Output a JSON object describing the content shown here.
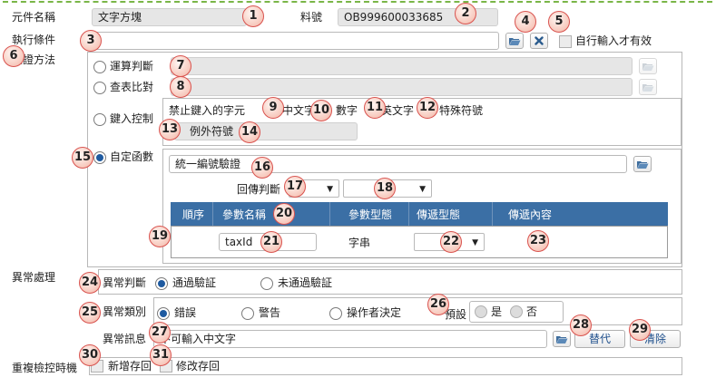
{
  "form": {
    "component_name": {
      "label": "元件名稱",
      "value": "文字方塊"
    },
    "part_no": {
      "label": "料號",
      "value": "OB999600033685"
    },
    "exec_condition": {
      "label": "執行條件",
      "value": "",
      "self_input_label": "自行輸入才有效"
    },
    "verify_method": {
      "label": "驗證方法",
      "calc": {
        "label": "運算判斷",
        "value": ""
      },
      "lookup": {
        "label": "查表比對",
        "value": ""
      },
      "key_control": {
        "label": "鍵入控制",
        "forbidden_label": "禁止鍵入的字元",
        "options": [
          "中文字",
          "數字",
          "英文字",
          "特殊符號"
        ],
        "exception_label": "例外符號",
        "exception_value": ""
      },
      "custom_func": {
        "label": "自定函數",
        "func_value": "統一編號驗證",
        "return_label": "回傳判斷",
        "return_sel1": "",
        "return_sel2": "",
        "table": {
          "headers": [
            "順序",
            "參數名稱",
            "參數型態",
            "傳遞型態",
            "傳遞內容"
          ],
          "row": {
            "order": "",
            "param_name": "taxId",
            "param_type": "字串",
            "pass_type": "",
            "pass_content": ""
          }
        }
      }
    },
    "exception": {
      "label": "異常處理",
      "judge": {
        "label": "異常判斷",
        "options": [
          "通過驗証",
          "未通過驗証"
        ]
      },
      "category": {
        "label": "異常類別",
        "options": [
          "錯誤",
          "警告",
          "操作者決定"
        ],
        "default_label": "預設",
        "default_options": [
          "是",
          "否"
        ]
      },
      "message": {
        "label": "異常訊息",
        "value": "不可輸入中文字",
        "replace_label": "替代",
        "clear_label": "清除"
      }
    },
    "repeat_check": {
      "label": "重複檢控時機",
      "options": [
        "新增存回",
        "修改存回"
      ]
    }
  },
  "badges": [
    "1",
    "2",
    "3",
    "4",
    "5",
    "6",
    "7",
    "8",
    "9",
    "10",
    "11",
    "12",
    "13",
    "14",
    "15",
    "16",
    "17",
    "18",
    "19",
    "20",
    "21",
    "22",
    "23",
    "24",
    "25",
    "26",
    "27",
    "28",
    "29",
    "30",
    "31"
  ]
}
